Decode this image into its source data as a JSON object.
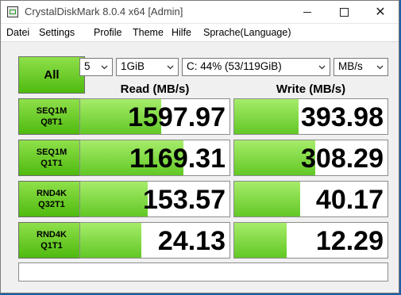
{
  "window": {
    "title": "CrystalDiskMark 8.0.4 x64 [Admin]"
  },
  "menu": [
    "Datei",
    "Settings",
    "Profile",
    "Theme",
    "Hilfe",
    "Sprache(Language)"
  ],
  "controls": {
    "all_label": "All",
    "count": "5",
    "size": "1GiB",
    "drive": "C: 44% (53/119GiB)",
    "unit": "MB/s"
  },
  "headers": {
    "read": "Read (MB/s)",
    "write": "Write (MB/s)"
  },
  "rows": [
    {
      "line1": "SEQ1M",
      "line2": "Q8T1",
      "read": "1597.97",
      "write": "393.98",
      "read_fill": 0.54,
      "write_fill": 0.42
    },
    {
      "line1": "SEQ1M",
      "line2": "Q1T1",
      "read": "1169.31",
      "write": "308.29",
      "read_fill": 0.69,
      "write_fill": 0.53
    },
    {
      "line1": "RND4K",
      "line2": "Q32T1",
      "read": "153.57",
      "write": "40.17",
      "read_fill": 0.45,
      "write_fill": 0.43
    },
    {
      "line1": "RND4K",
      "line2": "Q1T1",
      "read": "24.13",
      "write": "12.29",
      "read_fill": 0.41,
      "write_fill": 0.34
    }
  ],
  "status": ""
}
